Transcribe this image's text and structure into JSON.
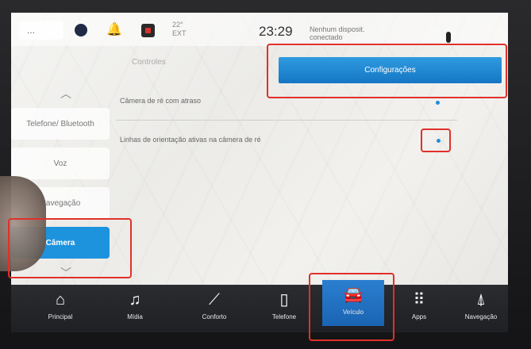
{
  "status_bar": {
    "back_label": "...",
    "temperature": "22°",
    "temperature_unit": "EXT",
    "time": "23:29",
    "station": "Nenhum disposit. conectado"
  },
  "settings_button": {
    "label": "Configurações"
  },
  "tab_label": "Controles",
  "side_menu": {
    "items": [
      {
        "label": "Telefone/ Bluetooth"
      },
      {
        "label": "Voz"
      },
      {
        "label": "Navegação"
      },
      {
        "label": "Câmera",
        "active": true
      }
    ]
  },
  "settings_rows": [
    {
      "label": "Câmera de ré com atraso"
    },
    {
      "label": "Linhas de orientação ativas na câmera de ré"
    }
  ],
  "bottom_nav": {
    "items": [
      {
        "label": "Principal",
        "icon": "home-icon"
      },
      {
        "label": "Mídia",
        "icon": "music-note-icon"
      },
      {
        "label": "Conforto",
        "icon": "seat-icon"
      },
      {
        "label": "Telefone",
        "icon": "phone-icon"
      },
      {
        "label": "Veículo",
        "icon": "car-icon",
        "active": true
      },
      {
        "label": "Apps",
        "icon": "apps-grid-icon"
      },
      {
        "label": "Navegação",
        "icon": "navigation-icon"
      }
    ]
  },
  "colors": {
    "accent": "#1d93dd",
    "highlight": "#e0302a",
    "nav_bg": "#23252a"
  }
}
